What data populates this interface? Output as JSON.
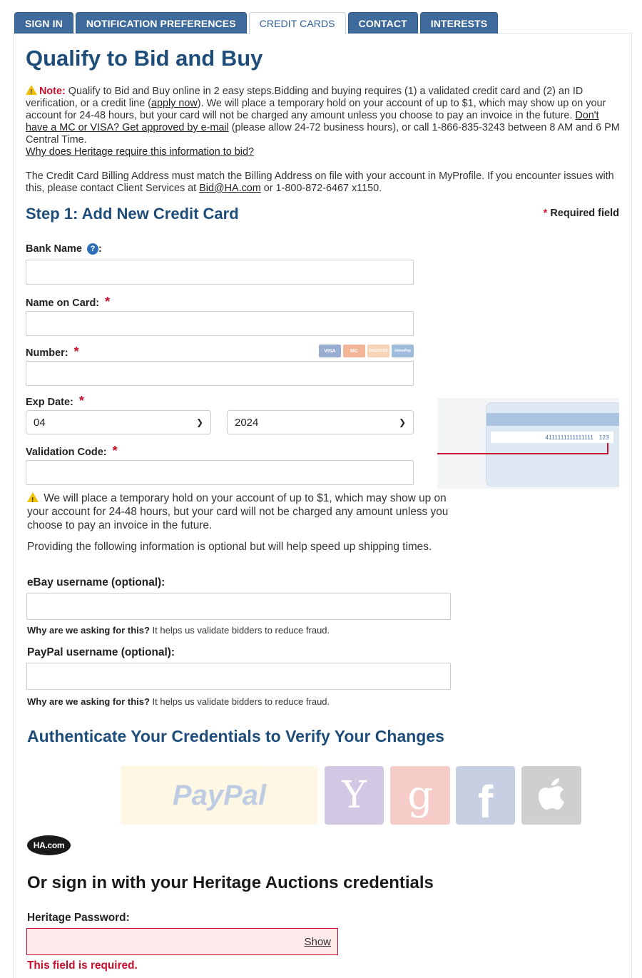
{
  "tabs": [
    {
      "label": "SIGN IN"
    },
    {
      "label": "NOTIFICATION PREFERENCES"
    },
    {
      "label": "CREDIT CARDS",
      "active": true
    },
    {
      "label": "CONTACT"
    },
    {
      "label": "INTERESTS"
    }
  ],
  "page_title": "Qualify to Bid and Buy",
  "note": {
    "label": "Note:",
    "text1": " Qualify to Bid and Buy online in 2 easy steps.Bidding and buying requires (1) a validated credit card and (2) an ID verification, or a credit line (",
    "apply_link": "apply now",
    "text2": "). We will place a temporary hold on your account of up to $1, which may show up on your account for 24-48 hours, but your card will not be charged any amount unless you choose to pay an invoice in the future. ",
    "approved_link": "Don't have a MC or VISA? Get approved by e-mail",
    "text3": " (please allow 24-72 business hours), or call 1-866-835-3243 between 8 AM and 6 PM Central Time.",
    "why_link": "Why does Heritage require this information to bid?"
  },
  "billing": {
    "text1": "The Credit Card Billing Address must match the Billing Address on file with your account in MyProfile. If you encounter issues with this, please contact Client Services at ",
    "email_link": "Bid@HA.com",
    "text2": " or 1-800-872-6467 x1150."
  },
  "step1": {
    "title": "Step 1: Add New Credit Card",
    "required_star": "*",
    "required_label": "Required field"
  },
  "fields": {
    "bank_name_label": "Bank Name",
    "name_on_card_label": "Name on Card:",
    "number_label": "Number:",
    "exp_date_label": "Exp Date:",
    "exp_month": "04",
    "exp_year": "2024",
    "validation_code_label": "Validation Code:",
    "star": "*"
  },
  "card_logos": [
    "VISA",
    "MC",
    "DISCOVER",
    "UnionPay"
  ],
  "cvv_example": {
    "number": "4111111111111111",
    "code": "123"
  },
  "hold_notice": "We will place a temporary hold on your account of up to $1, which may show up on your account for 24-48 hours, but your card will not be charged any amount unless you choose to pay an invoice in the future.",
  "optional_notice": "Providing the following information is optional but will help speed up shipping times.",
  "ebay": {
    "label": "eBay username (optional):",
    "why_bold": "Why are we asking for this?",
    "why_text": " It helps us validate bidders to reduce fraud."
  },
  "paypal": {
    "label": "PayPal username (optional):",
    "why_bold": "Why are we asking for this?",
    "why_text": " It helps us validate bidders to reduce fraud."
  },
  "auth_title": "Authenticate Your Credentials to Verify Your Changes",
  "social_buttons": [
    {
      "name": "PayPal",
      "color": "#f6c343"
    },
    {
      "name": "Y",
      "color": "#5f3e9c"
    },
    {
      "name": "g",
      "color": "#dd4b39"
    },
    {
      "name": "f",
      "color": "#3b5998"
    },
    {
      "name": "apple",
      "color": "#555555"
    }
  ],
  "ha_logo": "HA.com",
  "alt_signin_title": "Or sign in with your Heritage Auctions credentials",
  "password": {
    "label": "Heritage Password:",
    "show_label": "Show",
    "error": "This field is required."
  },
  "colors": {
    "tab_bg": "#3e6b9b",
    "heading": "#1f4d7a",
    "required": "#c8102e"
  }
}
